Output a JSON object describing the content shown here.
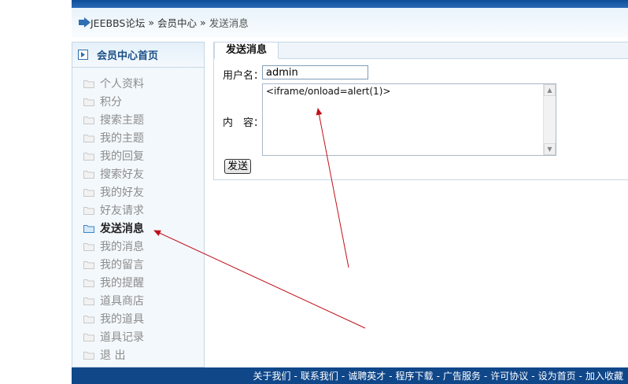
{
  "breadcrumb": {
    "home": "JEEBBS论坛",
    "sep1": "»",
    "member": "会员中心",
    "sep2": "»",
    "current": "发送消息"
  },
  "sidebar": {
    "title": "会员中心首页",
    "items": [
      {
        "label": "个人资料",
        "active": false
      },
      {
        "label": "积分",
        "active": false
      },
      {
        "label": "搜索主题",
        "active": false
      },
      {
        "label": "我的主题",
        "active": false
      },
      {
        "label": "我的回复",
        "active": false
      },
      {
        "label": "搜索好友",
        "active": false
      },
      {
        "label": "我的好友",
        "active": false
      },
      {
        "label": "好友请求",
        "active": false
      },
      {
        "label": "发送消息",
        "active": true
      },
      {
        "label": "我的消息",
        "active": false
      },
      {
        "label": "我的留言",
        "active": false
      },
      {
        "label": "我的提醒",
        "active": false
      },
      {
        "label": "道具商店",
        "active": false
      },
      {
        "label": "我的道具",
        "active": false
      },
      {
        "label": "道具记录",
        "active": false
      },
      {
        "label": "退 出",
        "active": false
      }
    ]
  },
  "form": {
    "tab_label": "发送消息",
    "username_label": "用户名：",
    "username_value": "admin",
    "content_label": "内　容：",
    "content_value": "<iframe/onload=alert(1)>",
    "send_label": "发送"
  },
  "footer": {
    "links": [
      "关于我们",
      "联系我们",
      "诚聘英才",
      "程序下载",
      "广告服务",
      "许可协议",
      "设为首页",
      "加入收藏"
    ],
    "separator": "-"
  },
  "colors": {
    "brand_blue": "#0f4789",
    "arrow_red": "#c0101a",
    "folder_active": "#3d86c6"
  }
}
